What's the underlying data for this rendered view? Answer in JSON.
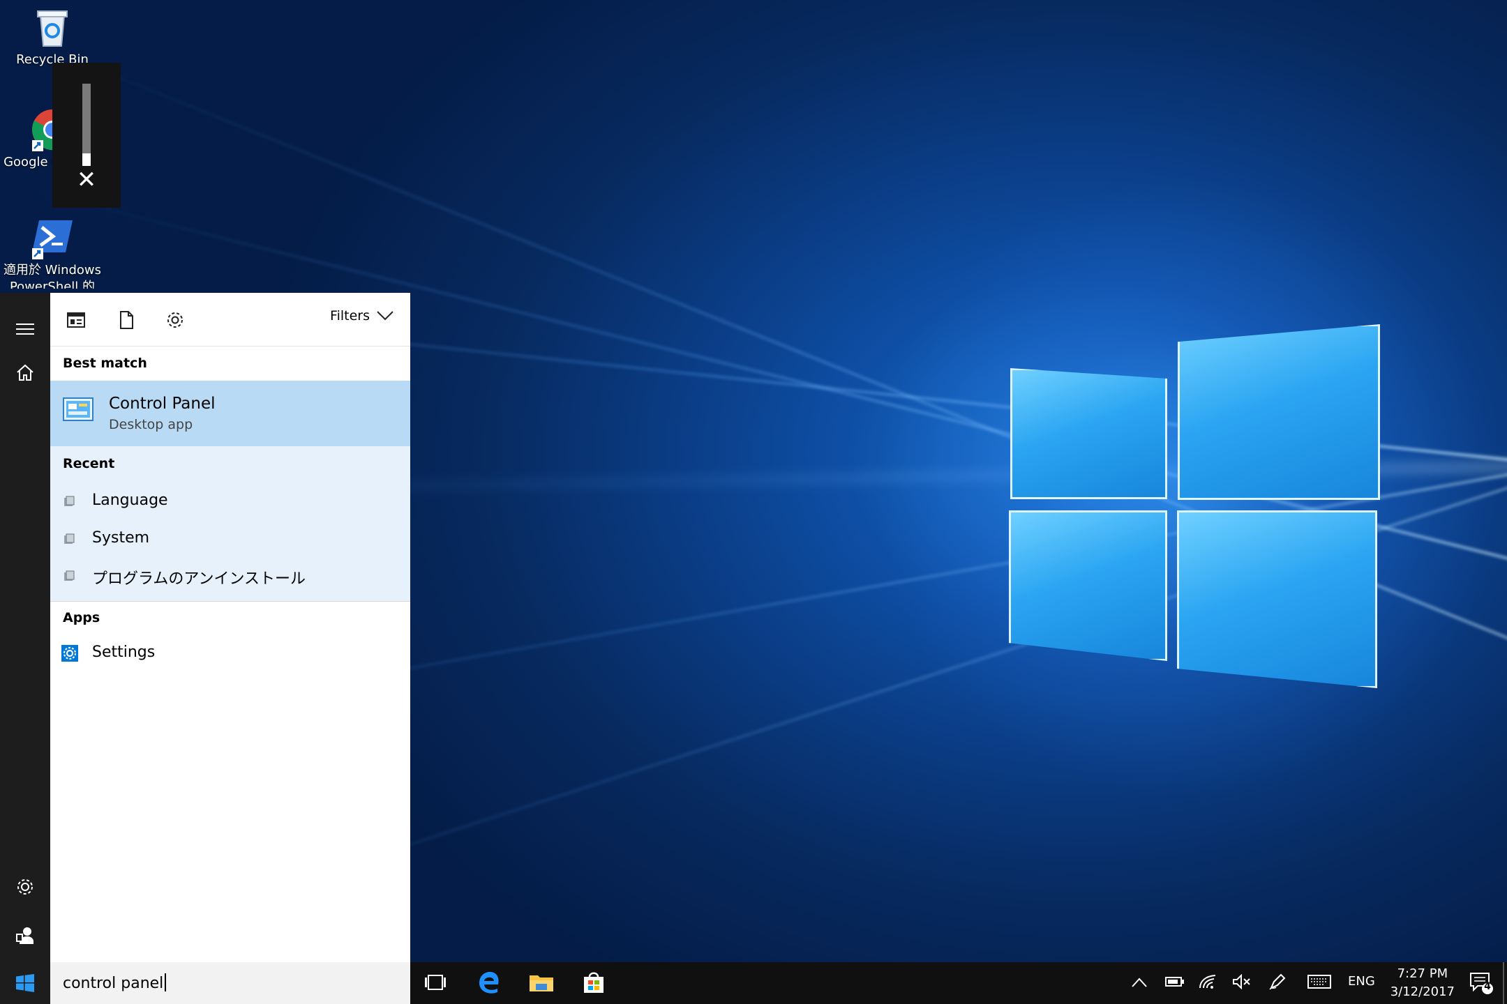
{
  "desktop": {
    "icons": [
      {
        "label": "Recycle Bin"
      },
      {
        "label": "Google Chrome"
      },
      {
        "label_line1": "適用於 Windows",
        "label_line2": "PowerShell 的 Wi..."
      }
    ]
  },
  "volume": {
    "level_fraction": 0.15,
    "close_glyph": "✕"
  },
  "search_panel": {
    "filters_label": "Filters",
    "best_match_heading": "Best match",
    "best_match": {
      "title": "Control Panel",
      "subtitle": "Desktop app"
    },
    "recent_heading": "Recent",
    "recent_items": [
      "Language",
      "System",
      "プログラムのアンインストール"
    ],
    "apps_heading": "Apps",
    "app_items": [
      "Settings"
    ]
  },
  "search_box": {
    "value": "control panel"
  },
  "tray": {
    "language": "ENG",
    "time": "7:27 PM",
    "date": "3/12/2017",
    "notification_count": "4"
  },
  "colors": {
    "accent": "#0078d7",
    "best_match_bg": "#b9daf5",
    "recent_bg": "#e6f1fb"
  }
}
